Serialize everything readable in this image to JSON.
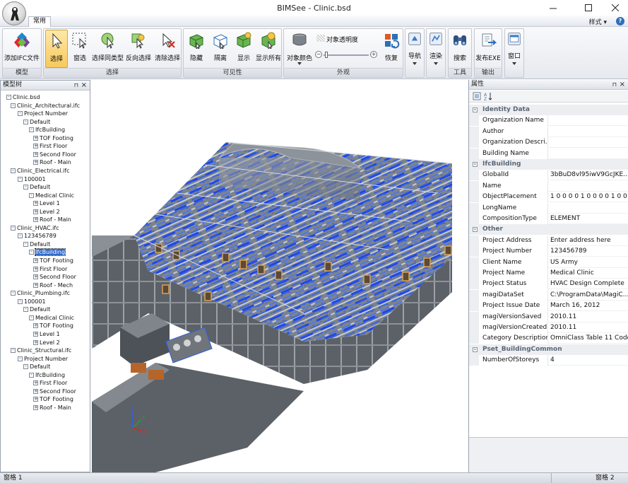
{
  "window": {
    "title": "BIMSee - Clinic.bsd",
    "controls": [
      "minimize",
      "maximize",
      "close"
    ]
  },
  "ribbon_tab": "常用",
  "style_menu": "样式",
  "ribbon_groups": {
    "model": {
      "label": "模型",
      "add_ifc": "添加IFC文件"
    },
    "select": {
      "label": "选择",
      "select": "选择",
      "window_select": "窗选",
      "select_same_type": "选择同类型",
      "invert_select": "反向选择",
      "clear_select": "清除选择"
    },
    "visibility": {
      "label": "可见性",
      "hide": "隐藏",
      "isolate": "隔离",
      "show": "显示",
      "show_all": "显示所有"
    },
    "appearance": {
      "label": "外观",
      "object_color": "对象颜色",
      "transparency": "对象透明度",
      "restore": "恢复"
    },
    "nav": {
      "navigate": "导航",
      "render": "渲染"
    },
    "tools": {
      "label": "工具",
      "search": "搜索"
    },
    "output": {
      "label": "输出",
      "publish": "发布EXE"
    },
    "window": {
      "label": "窗口"
    }
  },
  "model_tree": {
    "title": "模型树",
    "nodes": [
      {
        "label": "Clinic.bsd",
        "level": 0,
        "box": "-"
      },
      {
        "label": "Clinic_Architectural.ifc",
        "level": 1,
        "box": "-"
      },
      {
        "label": "Project Number",
        "level": 2,
        "box": "-"
      },
      {
        "label": "Default",
        "level": 3,
        "box": "-"
      },
      {
        "label": "IfcBuilding",
        "level": 4,
        "box": "-"
      },
      {
        "label": "TOF Footing",
        "level": 5,
        "box": "+"
      },
      {
        "label": "First Floor",
        "level": 5,
        "box": "+"
      },
      {
        "label": "Second Floor",
        "level": 5,
        "box": "+"
      },
      {
        "label": "Roof - Main",
        "level": 5,
        "box": "+"
      },
      {
        "label": "Clinic_Electrical.ifc",
        "level": 1,
        "box": "-"
      },
      {
        "label": "100001",
        "level": 2,
        "box": "-"
      },
      {
        "label": "Default",
        "level": 3,
        "box": "-"
      },
      {
        "label": "Medical Clinic",
        "level": 4,
        "box": "-"
      },
      {
        "label": "Level 1",
        "level": 5,
        "box": "+"
      },
      {
        "label": "Level 2",
        "level": 5,
        "box": "+"
      },
      {
        "label": "Roof - Main",
        "level": 5,
        "box": "+"
      },
      {
        "label": "Clinic_HVAC.ifc",
        "level": 1,
        "box": "-"
      },
      {
        "label": "123456789",
        "level": 2,
        "box": "-"
      },
      {
        "label": "Default",
        "level": 3,
        "box": "-"
      },
      {
        "label": "IfcBuilding",
        "level": 4,
        "box": "-",
        "selected": true
      },
      {
        "label": "TOF Footing",
        "level": 5,
        "box": "+"
      },
      {
        "label": "First Floor",
        "level": 5,
        "box": "+"
      },
      {
        "label": "Second Floor",
        "level": 5,
        "box": "+"
      },
      {
        "label": "Roof - Mech",
        "level": 5,
        "box": "+"
      },
      {
        "label": "Clinic_Plumbing.ifc",
        "level": 1,
        "box": "-"
      },
      {
        "label": "100001",
        "level": 2,
        "box": "-"
      },
      {
        "label": "Default",
        "level": 3,
        "box": "-"
      },
      {
        "label": "Medical Clinic",
        "level": 4,
        "box": "-"
      },
      {
        "label": "TOF Footing",
        "level": 5,
        "box": "+"
      },
      {
        "label": "Level 1",
        "level": 5,
        "box": "+"
      },
      {
        "label": "Level 2",
        "level": 5,
        "box": "+"
      },
      {
        "label": "Clinic_Structural.ifc",
        "level": 1,
        "box": "-"
      },
      {
        "label": "Project Number",
        "level": 2,
        "box": "-"
      },
      {
        "label": "Default",
        "level": 3,
        "box": "-"
      },
      {
        "label": "IfcBuilding",
        "level": 4,
        "box": "-"
      },
      {
        "label": "First Floor",
        "level": 5,
        "box": "+"
      },
      {
        "label": "Second Floor",
        "level": 5,
        "box": "+"
      },
      {
        "label": "TOF Footing",
        "level": 5,
        "box": "+"
      },
      {
        "label": "Roof - Main",
        "level": 5,
        "box": "+"
      }
    ]
  },
  "viewport": {
    "axes": [
      "X",
      "Y",
      "Z"
    ]
  },
  "properties": {
    "title": "属性",
    "categories": [
      {
        "name": "Identity Data",
        "rows": [
          [
            "Organization Name",
            ""
          ],
          [
            "Author",
            ""
          ],
          [
            "Organization Descri...",
            ""
          ],
          [
            "Building Name",
            ""
          ]
        ]
      },
      {
        "name": "IfcBuilding",
        "rows": [
          [
            "GlobalId",
            "3bBuD8vl95iwV9GcJKE..."
          ],
          [
            "Name",
            ""
          ],
          [
            "ObjectPlacement",
            "1 0 0 0 0 1 0 0 0 0 1 0 0 ..."
          ],
          [
            "LongName",
            ""
          ],
          [
            "CompositionType",
            "ELEMENT"
          ]
        ]
      },
      {
        "name": "Other",
        "rows": [
          [
            "Project Address",
            "Enter address here"
          ],
          [
            "Project Number",
            "123456789"
          ],
          [
            "Client Name",
            "US Army"
          ],
          [
            "Project Name",
            "Medical Clinic"
          ],
          [
            "Project Status",
            "HVAC Design Complete"
          ],
          [
            "magiDataSet",
            "C:\\ProgramData\\MagiC..."
          ],
          [
            "Project Issue Date",
            "March 16, 2012"
          ],
          [
            "magiVersionSaved",
            "2010.11"
          ],
          [
            "magiVersionCreated",
            "2010.11"
          ],
          [
            "Category Description",
            "OmniClass Table 11 Code"
          ]
        ]
      },
      {
        "name": "Pset_BuildingCommon",
        "rows": [
          [
            "NumberOfStoreys",
            "4"
          ]
        ]
      }
    ]
  },
  "status_bar": {
    "left": "窗格 1",
    "right": "窗格 2"
  }
}
